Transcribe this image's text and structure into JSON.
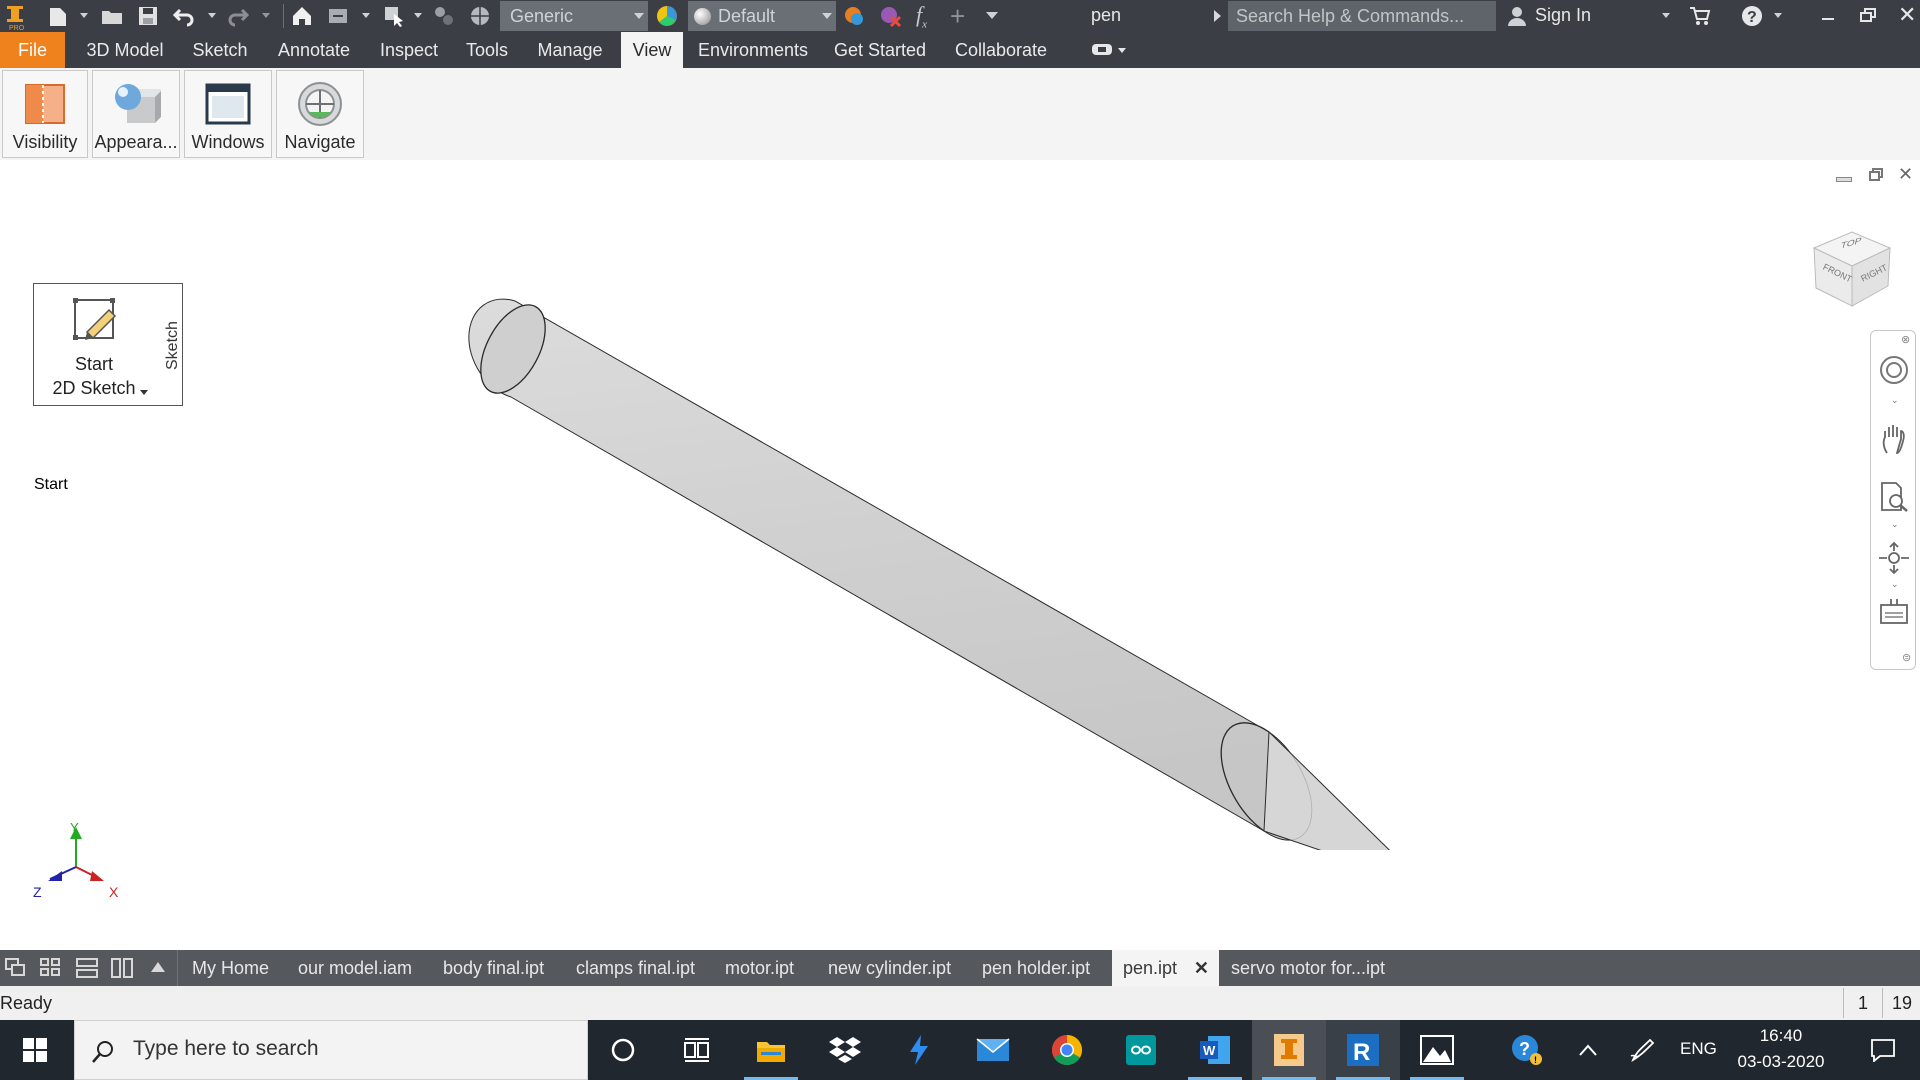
{
  "titlebar": {
    "material_combo": "Generic",
    "appearance_combo": "Default",
    "document_name": "pen",
    "search_placeholder": "Search Help & Commands...",
    "sign_in": "Sign In",
    "fx_label": "f"
  },
  "ribbon_tabs": [
    "File",
    "3D Model",
    "Sketch",
    "Annotate",
    "Inspect",
    "Tools",
    "Manage",
    "View",
    "Environments",
    "Get Started",
    "Collaborate"
  ],
  "active_tab": "View",
  "ribbon_panels": [
    "Visibility",
    "Appeara...",
    "Windows",
    "Navigate"
  ],
  "sketch_panel": {
    "button_line1": "Start",
    "button_line2": "2D Sketch",
    "panel_title": "Sketch"
  },
  "viewcube": {
    "top": "TOP",
    "front": "FRONT",
    "right": "RIGHT"
  },
  "triad": {
    "x": "X",
    "y": "Y",
    "z": "Z"
  },
  "document_tabs": [
    "My Home",
    "our model.iam",
    "body final.ipt",
    "clamps final.ipt",
    "motor.ipt",
    "new cylinder.ipt",
    "pen holder.ipt",
    "pen.ipt",
    "servo motor for...ipt"
  ],
  "active_document": "pen.ipt",
  "statusbar": {
    "text": "Ready",
    "count1": "1",
    "count2": "19"
  },
  "taskbar": {
    "search_placeholder": "Type here to search",
    "language": "ENG",
    "time": "16:40",
    "date": "03-03-2020"
  },
  "colors": {
    "accent_file_tab": "#f0821e",
    "titlebar_bg": "#3b3f45",
    "taskbar_bg": "#21272e",
    "model_fill": "#d3d3d3"
  }
}
